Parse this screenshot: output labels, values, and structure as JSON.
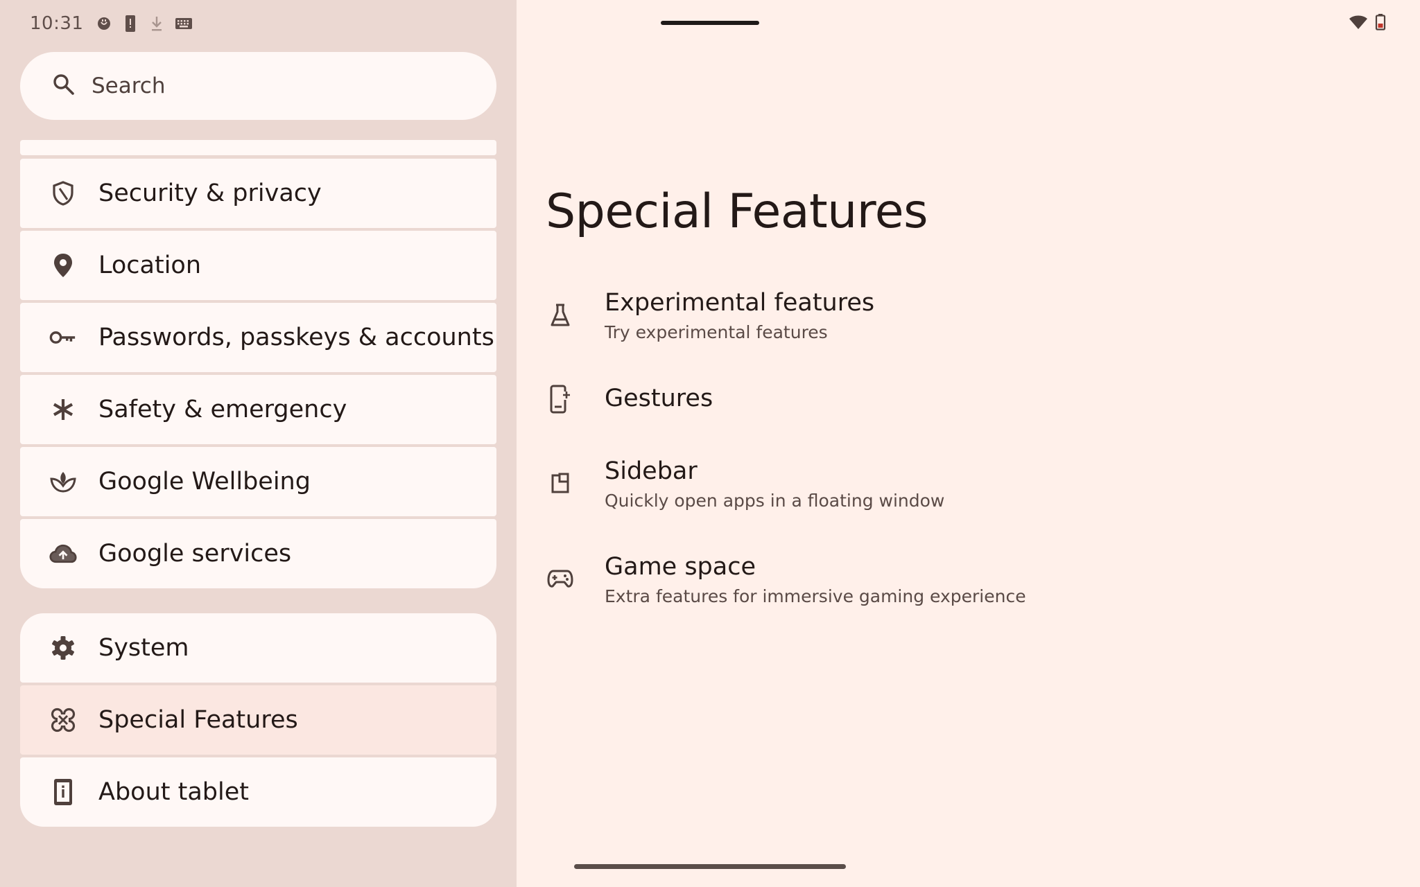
{
  "status_bar": {
    "time": "10:31",
    "left_icons": [
      "bugreport-icon",
      "alert-card-icon",
      "download-icon",
      "keyboard-icon"
    ],
    "right_icons": [
      "wifi-icon",
      "battery-icon"
    ]
  },
  "search": {
    "label": "Search"
  },
  "sidebar": {
    "items": [
      {
        "label": "Security & privacy",
        "icon": "shield-icon"
      },
      {
        "label": "Location",
        "icon": "location-pin-icon"
      },
      {
        "label": "Passwords, passkeys & accounts",
        "icon": "key-icon"
      },
      {
        "label": "Safety & emergency",
        "icon": "asterisk-icon"
      },
      {
        "label": "Google Wellbeing",
        "icon": "wellbeing-icon"
      },
      {
        "label": "Google services",
        "icon": "cloud-upload-icon"
      }
    ],
    "group2": [
      {
        "label": "System",
        "icon": "gear-icon"
      },
      {
        "label": "Special Features",
        "icon": "special-features-icon",
        "selected": true
      },
      {
        "label": "About tablet",
        "icon": "tablet-info-icon"
      }
    ]
  },
  "main": {
    "title": "Special Features",
    "features": [
      {
        "title": "Experimental features",
        "subtitle": "Try experimental features",
        "icon": "flask-icon"
      },
      {
        "title": "Gestures",
        "subtitle": "",
        "icon": "gestures-icon"
      },
      {
        "title": "Sidebar",
        "subtitle": "Quickly open apps in a floating window",
        "icon": "sidebar-icon"
      },
      {
        "title": "Game space",
        "subtitle": "Extra features for immersive gaming experience",
        "icon": "gamepad-icon"
      }
    ]
  },
  "colors": {
    "left_pane_bg": "#ebd8d2",
    "right_pane_bg": "#fff0ea",
    "card_bg": "#fff8f6",
    "selected_bg": "#fbe7e1",
    "text_primary": "#231917",
    "text_secondary": "#5a4a46",
    "icon": "#4f403c"
  }
}
